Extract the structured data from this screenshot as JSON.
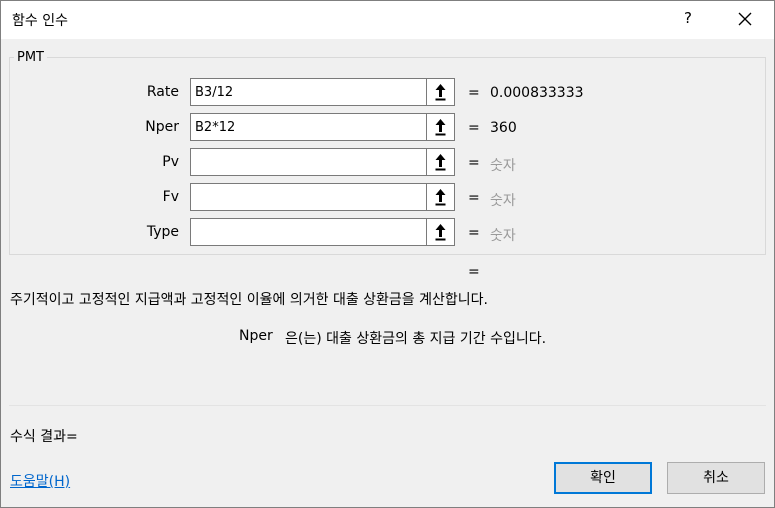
{
  "window": {
    "title": "함수 인수",
    "help_glyph": "?"
  },
  "function": {
    "name": "PMT",
    "arguments": [
      {
        "label": "Rate",
        "value": "B3/12",
        "result": "0.000833333",
        "result_is_placeholder": false
      },
      {
        "label": "Nper",
        "value": "B2*12",
        "result": "360",
        "result_is_placeholder": false
      },
      {
        "label": "Pv",
        "value": "",
        "result": "숫자",
        "result_is_placeholder": true
      },
      {
        "label": "Fv",
        "value": "",
        "result": "숫자",
        "result_is_placeholder": true
      },
      {
        "label": "Type",
        "value": "",
        "result": "숫자",
        "result_is_placeholder": true
      }
    ],
    "equals_sign": "=",
    "overall_result": "",
    "description": "주기적이고 고정적인 지급액과 고정적인 이율에 의거한 대출 상환금을 계산합니다.",
    "current_arg_name": "Nper",
    "current_arg_description": "은(는) 대출 상환금의 총 지급 기간 수입니다."
  },
  "footer": {
    "formula_result_label": "수식 결과=",
    "help_link": "도움말(H)",
    "ok_label": "확인",
    "cancel_label": "취소"
  },
  "icons": {
    "collapse": "arrow-up-collapse-icon",
    "close": "close-icon"
  },
  "colors": {
    "link": "#0066cc",
    "ok_border": "#0078d7",
    "placeholder": "#9a9a9a"
  }
}
